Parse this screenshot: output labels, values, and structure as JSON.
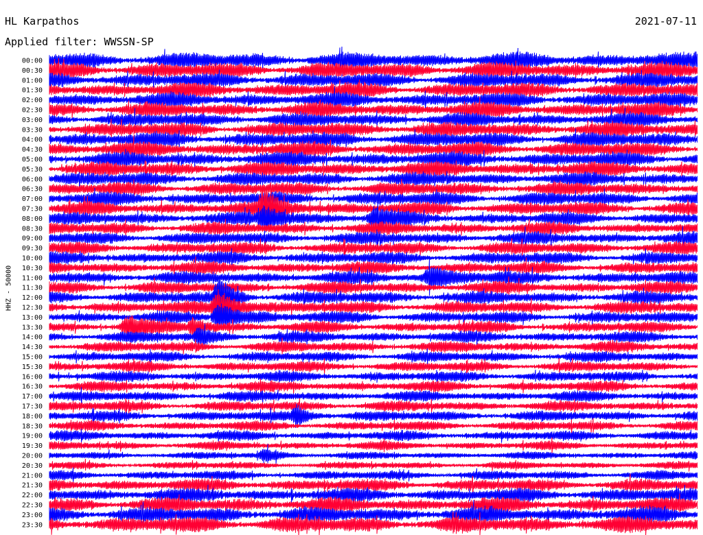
{
  "header": {
    "station": "HL Karpathos",
    "date": "2021-07-11",
    "filter": "Applied filter: WWSSN-SP"
  },
  "colors": {
    "trace_a": "#0000ff",
    "trace_b": "#ff0033",
    "background": "#ffffff",
    "text": "#000000"
  },
  "chart_data": {
    "type": "line",
    "title": "HL Karpathos",
    "ylabel": "HHZ - 50000",
    "row_labels": [
      "00:00",
      "00:30",
      "01:00",
      "01:30",
      "02:00",
      "02:30",
      "03:00",
      "03:30",
      "04:00",
      "04:30",
      "05:00",
      "05:30",
      "06:00",
      "06:30",
      "07:00",
      "07:30",
      "08:00",
      "08:30",
      "09:00",
      "09:30",
      "10:00",
      "10:30",
      "11:00",
      "11:30",
      "12:00",
      "12:30",
      "13:00",
      "13:30",
      "14:00",
      "14:30",
      "15:00",
      "15:30",
      "16:00",
      "16:30",
      "17:00",
      "17:30",
      "18:00",
      "18:30",
      "19:00",
      "19:30",
      "20:00",
      "20:30",
      "21:00",
      "21:30",
      "22:00",
      "22:30",
      "23:00",
      "23:30"
    ],
    "row_colors": [
      "trace_a",
      "trace_b"
    ],
    "row_amplitude": [
      1.3,
      1.3,
      1.2,
      1.2,
      1.2,
      1.2,
      1.1,
      1.2,
      1.2,
      1.2,
      1.2,
      1.2,
      1.1,
      1.1,
      1.1,
      1.1,
      1.0,
      1.0,
      1.0,
      1.0,
      1.0,
      1.0,
      1.0,
      1.0,
      1.0,
      1.0,
      0.95,
      0.9,
      0.9,
      0.9,
      0.85,
      0.85,
      0.85,
      0.85,
      0.85,
      0.85,
      0.85,
      0.8,
      0.8,
      0.7,
      0.6,
      0.6,
      0.75,
      1.0,
      1.1,
      1.2,
      1.3,
      1.3
    ],
    "events": [
      {
        "row": 15,
        "x": 0.33,
        "width": 0.03,
        "amp": 2.2
      },
      {
        "row": 16,
        "x": 0.33,
        "width": 0.03,
        "amp": 1.8
      },
      {
        "row": 24,
        "x": 0.26,
        "width": 0.02,
        "amp": 3.0
      },
      {
        "row": 25,
        "x": 0.26,
        "width": 0.03,
        "amp": 2.6
      },
      {
        "row": 26,
        "x": 0.26,
        "width": 0.03,
        "amp": 2.4
      },
      {
        "row": 27,
        "x": 0.12,
        "width": 0.03,
        "amp": 1.6
      },
      {
        "row": 27,
        "x": 0.22,
        "width": 0.02,
        "amp": 1.5
      },
      {
        "row": 28,
        "x": 0.23,
        "width": 0.02,
        "amp": 1.4
      },
      {
        "row": 36,
        "x": 0.38,
        "width": 0.02,
        "amp": 1.7
      },
      {
        "row": 40,
        "x": 0.33,
        "width": 0.02,
        "amp": 1.4
      },
      {
        "row": 22,
        "x": 0.59,
        "width": 0.04,
        "amp": 1.5
      },
      {
        "row": 16,
        "x": 0.5,
        "width": 0.03,
        "amp": 1.3
      }
    ]
  }
}
